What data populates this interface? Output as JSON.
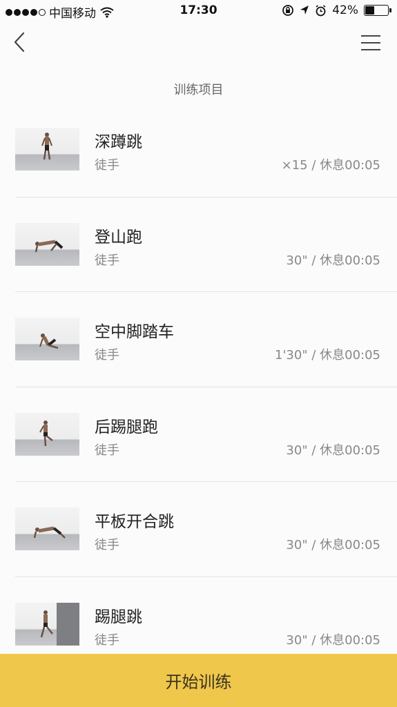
{
  "status_bar": {
    "carrier": "中国移动",
    "time": "17:30",
    "battery_percent_label": "42%",
    "battery_level": 0.42,
    "icons": [
      "signal-dots",
      "wifi-icon",
      "rotation-lock-icon",
      "location-icon",
      "alarm-icon",
      "battery-icon"
    ]
  },
  "nav": {
    "back_icon": "chevron-left-icon",
    "menu_icon": "menu-icon"
  },
  "section_title": "训练项目",
  "exercises": [
    {
      "name": "深蹲跳",
      "equipment": "徒手",
      "detail": "×15 / 休息00:05"
    },
    {
      "name": "登山跑",
      "equipment": "徒手",
      "detail": "30\" / 休息00:05"
    },
    {
      "name": "空中脚踏车",
      "equipment": "徒手",
      "detail": "1'30\" / 休息00:05"
    },
    {
      "name": "后踢腿跑",
      "equipment": "徒手",
      "detail": "30\" / 休息00:05"
    },
    {
      "name": "平板开合跳",
      "equipment": "徒手",
      "detail": "30\" / 休息00:05"
    },
    {
      "name": "踢腿跳",
      "equipment": "徒手",
      "detail": "30\" / 休息00:05"
    }
  ],
  "start_button_label": "开始训练",
  "colors": {
    "accent": "#efc74a",
    "background": "#fbfbfc",
    "divider": "#e3e3e6"
  }
}
